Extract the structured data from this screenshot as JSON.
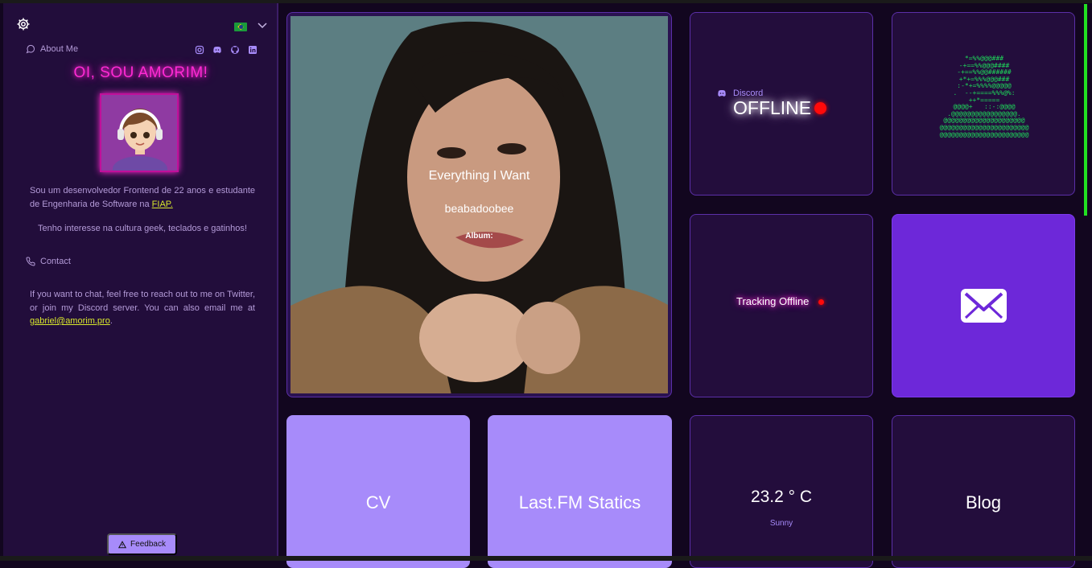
{
  "sidebar": {
    "settings_icon": "gear-icon",
    "language_flag": "brazil-flag-icon",
    "about_label": "About Me",
    "greeting": "OI, SOU AMORIM!",
    "bio_text": "Sou um desenvolvedor Frontend de 22 anos e estudante de Engenharia de Software na ",
    "bio_link": "FIAP.",
    "interests": "Tenho interesse na cultura geek, teclados e gatinhos!",
    "contact_label": "Contact",
    "contact_text": "If you want to chat, feel free to reach out to me on Twitter, or join my Discord server. You can also email me at ",
    "contact_email": "gabriel@amorim.pro",
    "contact_end": ".",
    "feedback_label": "Feedback",
    "social_icons": [
      "instagram-icon",
      "discord-icon",
      "github-icon",
      "linkedin-icon"
    ]
  },
  "now_playing": {
    "song": "Everything I Want",
    "artist": "beabadoobee",
    "album_label": "Album:"
  },
  "discord": {
    "label": "Discord",
    "status": "OFFLINE",
    "status_color": "#ff0a0a"
  },
  "ascii_art": "*=%%@@@###\n-+==%%@@@####\n-+==%%@@######\n+*+=%%%@@@###\n:-*+=%%%%@@@@@\n.  --+====%%%@%:\n++*=====\n@@@@+   ::-:@@@@\n.@@@@@@@@@@@@@@@@@.\n@@@@@@@@@@@@@@@@@@@@@\n@@@@@@@@@@@@@@@@@@@@@@@\n@@@@@@@@@@@@@@@@@@@@@@@",
  "tracking": {
    "text": "Tracking Offline"
  },
  "tiles": {
    "cv": "CV",
    "lastfm": "Last.FM Statics",
    "blog": "Blog"
  },
  "weather": {
    "temperature": "23.2 ° C",
    "condition": "Sunny"
  },
  "colors": {
    "accent_purple": "#a78bfa",
    "neon_pink": "#ff2ad4",
    "link_yellow": "#d8e82c",
    "mail_bg": "#6d28d9",
    "ascii_green": "#1ed85a"
  }
}
